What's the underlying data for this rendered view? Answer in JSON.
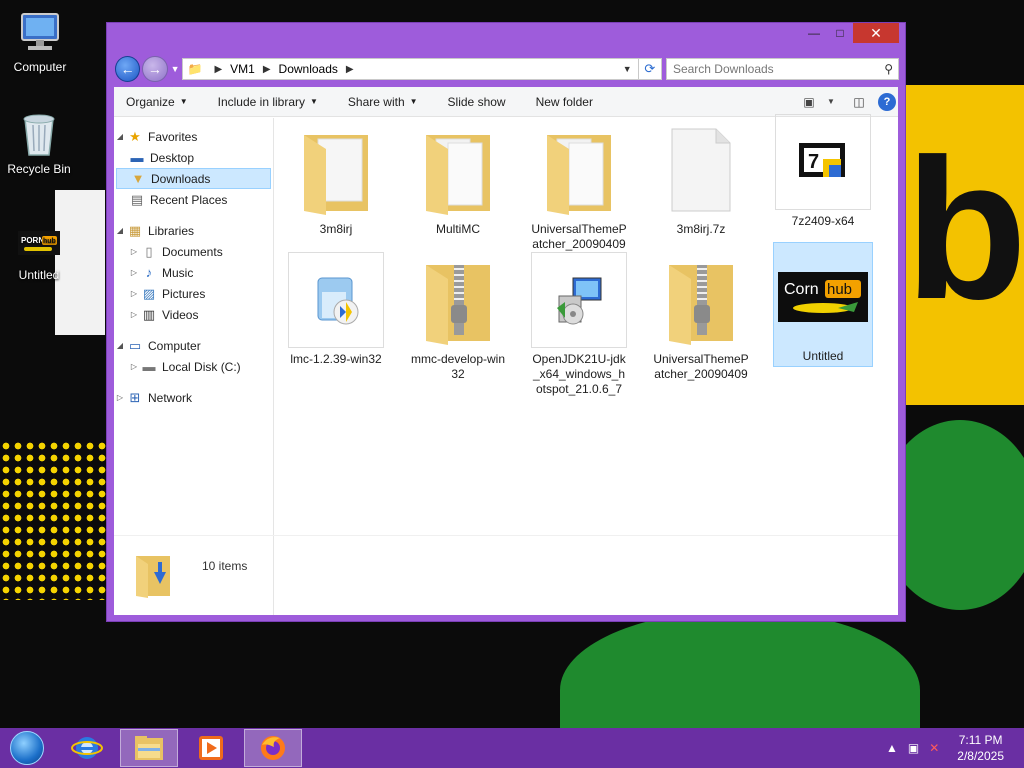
{
  "desktop": {
    "icons": [
      {
        "label": "Computer"
      },
      {
        "label": "Recycle Bin"
      },
      {
        "label": "Untitled"
      }
    ]
  },
  "window": {
    "controls": {
      "minimize": "—",
      "maximize": "□",
      "close": "✕"
    },
    "address": {
      "crumbs": [
        "VM1",
        "Downloads"
      ]
    },
    "search": {
      "placeholder": "Search Downloads"
    },
    "toolbar": {
      "organize": "Organize",
      "include_in_library": "Include in library",
      "share_with": "Share with",
      "slide_show": "Slide show",
      "new_folder": "New folder"
    },
    "nav": {
      "favorites": "Favorites",
      "desktop": "Desktop",
      "downloads": "Downloads",
      "recent_places": "Recent Places",
      "libraries": "Libraries",
      "documents": "Documents",
      "music": "Music",
      "pictures": "Pictures",
      "videos": "Videos",
      "computer": "Computer",
      "local_disk": "Local Disk (C:)",
      "network": "Network"
    },
    "files": [
      {
        "name": "3m8irj",
        "kind": "folder"
      },
      {
        "name": "MultiMC",
        "kind": "folder"
      },
      {
        "name": "UniversalThemePatcher_20090409",
        "kind": "folder"
      },
      {
        "name": "3m8irj.7z",
        "kind": "blank-file"
      },
      {
        "name": "7z2409-x64",
        "kind": "7zip-installer"
      },
      {
        "name": "lmc-1.2.39-win32",
        "kind": "installer"
      },
      {
        "name": "mmc-develop-win32",
        "kind": "zip-folder"
      },
      {
        "name": "OpenJDK21U-jdk_x64_windows_hotspot_21.0.6_7",
        "kind": "installer-pc"
      },
      {
        "name": "UniversalThemePatcher_20090409",
        "kind": "zip-folder"
      },
      {
        "name": "Untitled",
        "kind": "image"
      }
    ],
    "status": {
      "item_count": "10 items"
    }
  },
  "thumbnail_logo": {
    "left": "Corn",
    "right": "hub"
  },
  "desktop_logo": {
    "left": "PORN",
    "right": "hub"
  },
  "taskbar": {
    "time": "7:11 PM",
    "date": "2/8/2025"
  },
  "colors": {
    "window_frame": "#9e5cdb",
    "taskbar": "#6a2fa3",
    "selection": "#cce8ff",
    "close_button": "#c7372f"
  }
}
